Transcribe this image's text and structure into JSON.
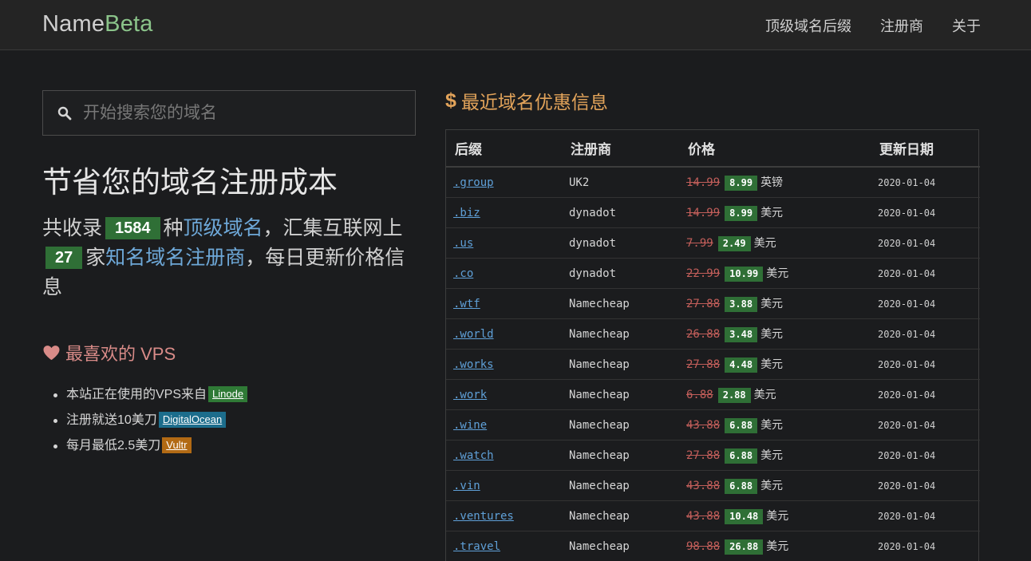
{
  "brand": {
    "name_part1": "Name",
    "name_part2": "Beta"
  },
  "nav": {
    "items": [
      "顶级域名后缀",
      "注册商",
      "关于"
    ]
  },
  "search": {
    "placeholder": "开始搜索您的域名"
  },
  "hero": {
    "title": "节省您的域名注册成本",
    "prefix1": "共收录",
    "tld_count": "1584",
    "mid1": "种",
    "tld_link": "顶级域名",
    "mid2": "，汇集互联网上",
    "registrar_count": "27",
    "mid3": "家",
    "registrar_link": "知名域名注册商",
    "suffix": "，每日更新价格信息"
  },
  "vps": {
    "title": "最喜欢的 VPS",
    "items": [
      {
        "text": "本站正在使用的VPS来自",
        "tag": "Linode",
        "color": "#2f7a36"
      },
      {
        "text": "注册就送10美刀",
        "tag": "DigitalOcean",
        "color": "#1c6d8c"
      },
      {
        "text": "每月最低2.5美刀",
        "tag": "Vultr",
        "color": "#b26a14"
      }
    ]
  },
  "deals": {
    "title": "最近域名优惠信息",
    "columns": [
      "后缀",
      "注册商",
      "价格",
      "更新日期"
    ],
    "rows": [
      {
        "suffix": ".group",
        "registrar": "UK2",
        "old": "14.99",
        "new": "8.99",
        "currency": "英镑",
        "date": "2020-01-04"
      },
      {
        "suffix": ".biz",
        "registrar": "dynadot",
        "old": "14.99",
        "new": "8.99",
        "currency": "美元",
        "date": "2020-01-04"
      },
      {
        "suffix": ".us",
        "registrar": "dynadot",
        "old": "7.99",
        "new": "2.49",
        "currency": "美元",
        "date": "2020-01-04"
      },
      {
        "suffix": ".co",
        "registrar": "dynadot",
        "old": "22.99",
        "new": "10.99",
        "currency": "美元",
        "date": "2020-01-04"
      },
      {
        "suffix": ".wtf",
        "registrar": "Namecheap",
        "old": "27.88",
        "new": "3.88",
        "currency": "美元",
        "date": "2020-01-04"
      },
      {
        "suffix": ".world",
        "registrar": "Namecheap",
        "old": "26.88",
        "new": "3.48",
        "currency": "美元",
        "date": "2020-01-04"
      },
      {
        "suffix": ".works",
        "registrar": "Namecheap",
        "old": "27.88",
        "new": "4.48",
        "currency": "美元",
        "date": "2020-01-04"
      },
      {
        "suffix": ".work",
        "registrar": "Namecheap",
        "old": "6.88",
        "new": "2.88",
        "currency": "美元",
        "date": "2020-01-04"
      },
      {
        "suffix": ".wine",
        "registrar": "Namecheap",
        "old": "43.88",
        "new": "6.88",
        "currency": "美元",
        "date": "2020-01-04"
      },
      {
        "suffix": ".watch",
        "registrar": "Namecheap",
        "old": "27.88",
        "new": "6.88",
        "currency": "美元",
        "date": "2020-01-04"
      },
      {
        "suffix": ".vin",
        "registrar": "Namecheap",
        "old": "43.88",
        "new": "6.88",
        "currency": "美元",
        "date": "2020-01-04"
      },
      {
        "suffix": ".ventures",
        "registrar": "Namecheap",
        "old": "43.88",
        "new": "10.48",
        "currency": "美元",
        "date": "2020-01-04"
      },
      {
        "suffix": ".travel",
        "registrar": "Namecheap",
        "old": "98.88",
        "new": "26.88",
        "currency": "美元",
        "date": "2020-01-04"
      }
    ]
  }
}
